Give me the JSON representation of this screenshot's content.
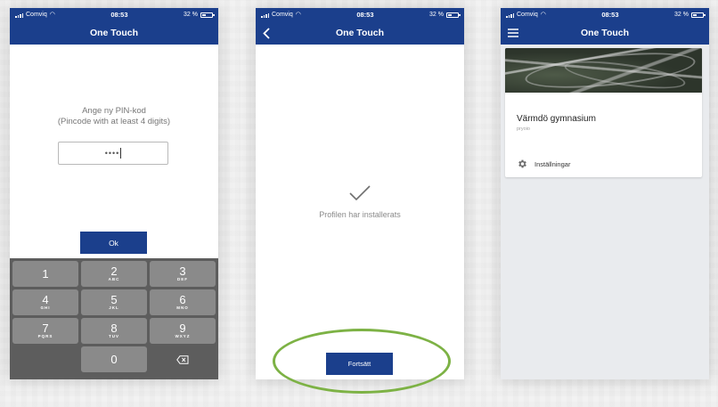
{
  "status": {
    "carrier": "Comviq",
    "time": "08:53",
    "battery": "32 %"
  },
  "app": {
    "title": "One Touch"
  },
  "screen_pin": {
    "prompt_line1": "Ange ny PIN-kod",
    "prompt_line2": "(Pincode with at least 4 digits)",
    "pin_value": "••••",
    "ok_label": "Ok",
    "keypad": [
      [
        {
          "digit": "1",
          "letters": ""
        },
        {
          "digit": "2",
          "letters": "ABC"
        },
        {
          "digit": "3",
          "letters": "DEF"
        }
      ],
      [
        {
          "digit": "4",
          "letters": "GHI"
        },
        {
          "digit": "5",
          "letters": "JKL"
        },
        {
          "digit": "6",
          "letters": "MNO"
        }
      ],
      [
        {
          "digit": "7",
          "letters": "PQRS"
        },
        {
          "digit": "8",
          "letters": "TUV"
        },
        {
          "digit": "9",
          "letters": "WXYZ"
        }
      ],
      [
        {
          "digit": "",
          "letters": ""
        },
        {
          "digit": "0",
          "letters": ""
        },
        {
          "digit": "",
          "letters": ""
        }
      ]
    ]
  },
  "screen_done": {
    "message": "Profilen har installerats",
    "continue_label": "Fortsätt",
    "highlight_color": "#7db245"
  },
  "screen_home": {
    "card_title": "Värmdö gymnasium",
    "card_subtitle": "pryoio",
    "settings_label": "Inställningar"
  },
  "colors": {
    "brand": "#1b3f8c",
    "keypad_bg": "#5d5d5d",
    "key_bg": "#8a8a8a"
  },
  "icons": {
    "back": "chevron-left-icon",
    "menu": "hamburger-menu-icon",
    "check": "checkmark-icon",
    "settings": "gear-icon",
    "backspace": "backspace-icon"
  }
}
